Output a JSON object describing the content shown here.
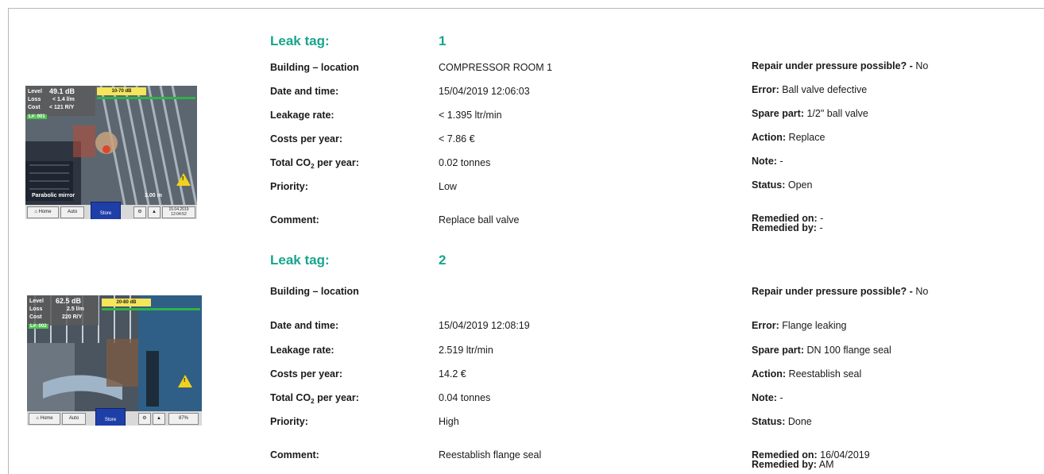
{
  "entries": [
    {
      "title": "Leak tag:",
      "number": "1",
      "labels": {
        "building": "Building – location",
        "datetime": "Date and time:",
        "leakage": "Leakage rate:",
        "costs": "Costs per year:",
        "co2_prefix": "Total CO",
        "co2_sub": "2",
        "co2_suffix": " per year:",
        "priority": "Priority:",
        "comment": "Comment:"
      },
      "values": {
        "building": "COMPRESSOR ROOM 1",
        "datetime": "15/04/2019 12:06:03",
        "leakage": "< 1.395 ltr/min",
        "costs": "< 7.86 €",
        "co2": "0.02 tonnes",
        "priority": "Low",
        "comment": "Replace ball valve"
      },
      "right": {
        "repair_label": "Repair under pressure possible? -",
        "repair_value": " No",
        "error_label": "Error:",
        "error_value": " Ball valve defective",
        "spare_label": "Spare part:",
        "spare_value": " 1/2\" ball valve",
        "action_label": "Action:",
        "action_value": " Replace",
        "note_label": "Note:",
        "note_value": " -",
        "status_label": "Status:",
        "status_value": " Open",
        "remedied_on_label": "Remedied on:",
        "remedied_on_value": " -",
        "remedied_by_label": "Remedied by:",
        "remedied_by_value": " -"
      },
      "thumb": {
        "level_label": "Level",
        "level_value": "49.1 dB",
        "loss_label": "Loss",
        "loss_value": "< 1.4 l/m",
        "cost_label": "Cost",
        "cost_value": "< 121 R/Y",
        "range": "10-70 dB",
        "lnum": "L#: 001",
        "mode": "Parabolic mirror",
        "dist": "3.00 m",
        "home": "Home",
        "auto": "Auto",
        "store": "Store",
        "date": "15.04.2019",
        "time": "12:04:52"
      }
    },
    {
      "title": "Leak tag:",
      "number": "2",
      "labels": {
        "building": "Building – location",
        "datetime": "Date and time:",
        "leakage": "Leakage rate:",
        "costs": "Costs per year:",
        "co2_prefix": "Total CO",
        "co2_sub": "2",
        "co2_suffix": " per year:",
        "priority": "Priority:",
        "comment": "Comment:"
      },
      "values": {
        "building": "",
        "datetime": "15/04/2019 12:08:19",
        "leakage": "2.519 ltr/min",
        "costs": "14.2 €",
        "co2": "0.04 tonnes",
        "priority": "High",
        "comment": "Reestablish flange seal"
      },
      "right": {
        "repair_label": "Repair under pressure possible? -",
        "repair_value": " No",
        "error_label": "Error:",
        "error_value": " Flange leaking",
        "spare_label": "Spare part:",
        "spare_value": " DN 100 flange seal",
        "action_label": "Action:",
        "action_value": " Reestablish seal",
        "note_label": "Note:",
        "note_value": " -",
        "status_label": "Status:",
        "status_value": " Done",
        "remedied_on_label": "Remedied on:",
        "remedied_on_value": " 16/04/2019",
        "remedied_by_label": "Remedied by:",
        "remedied_by_value": " AM"
      },
      "thumb": {
        "level_label": "Level",
        "level_value": "62.5 dB",
        "loss_label": "Loss",
        "loss_value": "2.5 l/m",
        "cost_label": "Cost",
        "cost_value": "220 R/Y",
        "range": "20-80 dB",
        "lnum": "L#: 002",
        "home": "Home",
        "auto": "Auto",
        "store": "Store",
        "battery": "87%"
      }
    }
  ]
}
